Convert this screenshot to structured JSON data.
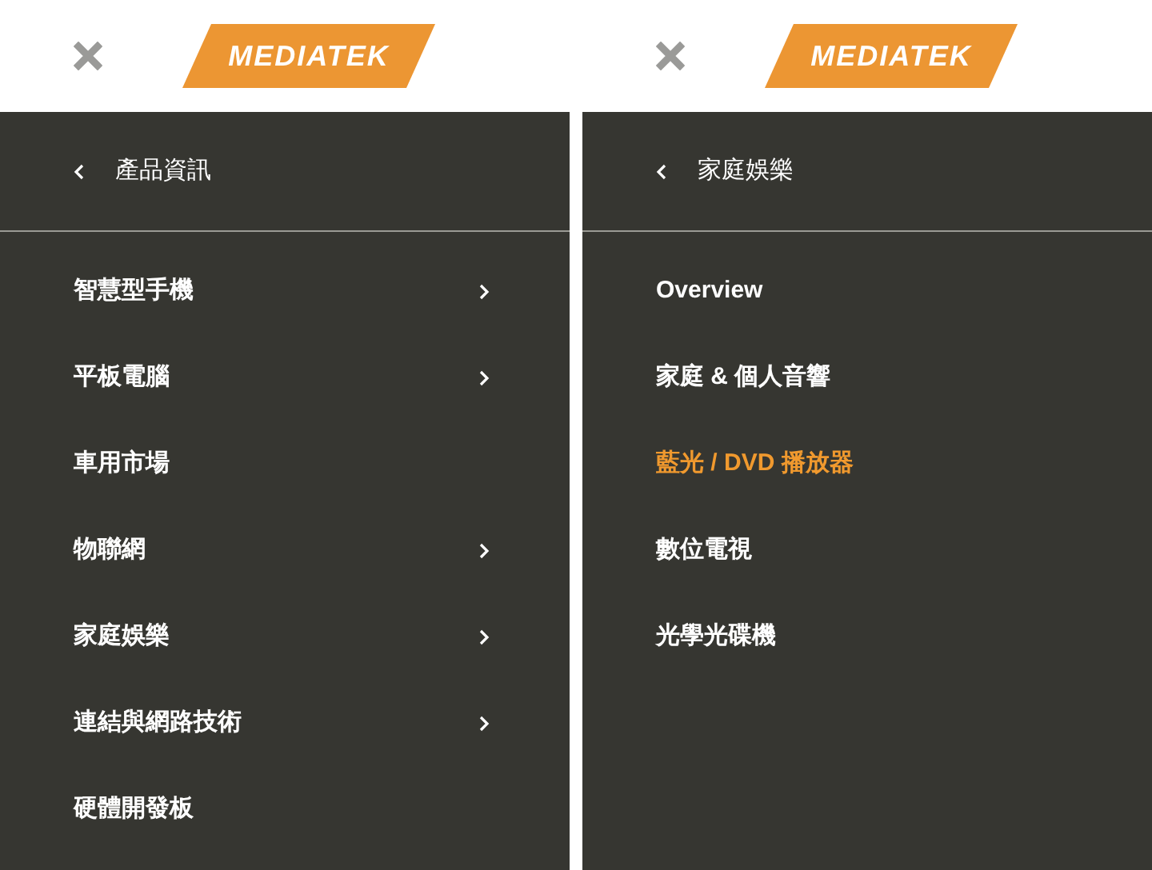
{
  "panels": [
    {
      "logo": "MEDIATEK",
      "back": "產品資訊",
      "items": [
        {
          "label": "智慧型手機",
          "has_children": true,
          "selected": false
        },
        {
          "label": "平板電腦",
          "has_children": true,
          "selected": false
        },
        {
          "label": "車用市場",
          "has_children": false,
          "selected": false
        },
        {
          "label": "物聯網",
          "has_children": true,
          "selected": false
        },
        {
          "label": "家庭娛樂",
          "has_children": true,
          "selected": false
        },
        {
          "label": "連結與網路技術",
          "has_children": true,
          "selected": false
        },
        {
          "label": "硬體開發板",
          "has_children": false,
          "selected": false
        }
      ]
    },
    {
      "logo": "MEDIATEK",
      "back": "家庭娛樂",
      "items": [
        {
          "label": "Overview",
          "has_children": false,
          "selected": false
        },
        {
          "label": "家庭 & 個人音響",
          "has_children": false,
          "selected": false
        },
        {
          "label": "藍光 / DVD 播放器",
          "has_children": false,
          "selected": true
        },
        {
          "label": "數位電視",
          "has_children": false,
          "selected": false
        },
        {
          "label": "光學光碟機",
          "has_children": false,
          "selected": false
        }
      ]
    }
  ]
}
